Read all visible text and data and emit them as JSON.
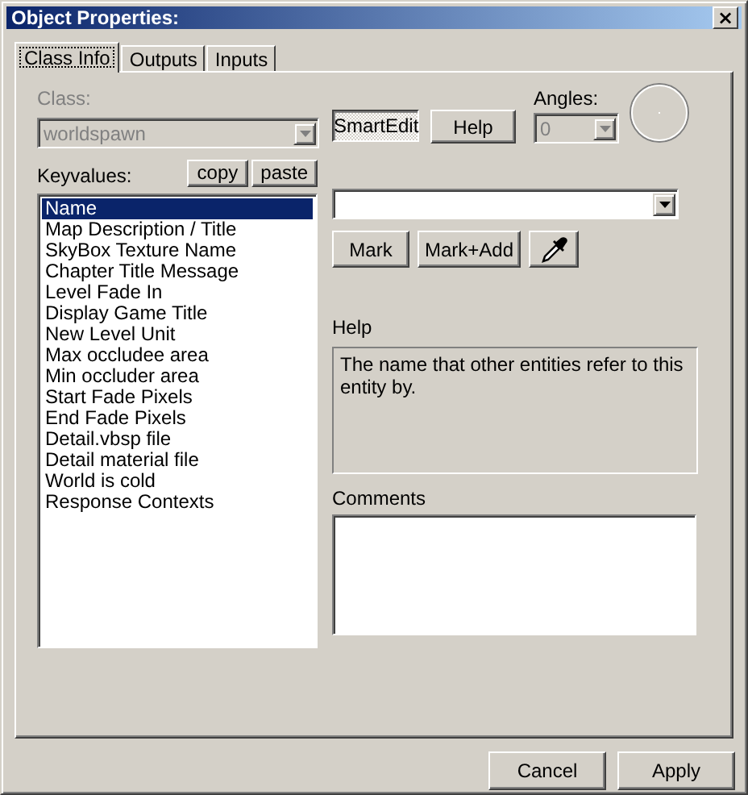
{
  "window": {
    "title": "Object Properties:",
    "close": "×"
  },
  "tabs": [
    {
      "label": "Class Info",
      "selected": true
    },
    {
      "label": "Outputs",
      "selected": false
    },
    {
      "label": "Inputs",
      "selected": false
    }
  ],
  "class_field": {
    "label": "Class:",
    "value": "worldspawn",
    "disabled": true
  },
  "smartedit_button": {
    "label": "SmartEdit",
    "pressed": true
  },
  "help_button": "Help",
  "angles": {
    "label": "Angles:",
    "value": "0",
    "disabled": true
  },
  "keyvalues": {
    "label": "Keyvalues:",
    "copy": "copy",
    "paste": "paste",
    "items": [
      {
        "label": "Name",
        "selected": true
      },
      {
        "label": "Map Description / Title",
        "selected": false
      },
      {
        "label": "SkyBox Texture Name",
        "selected": false
      },
      {
        "label": "Chapter Title Message",
        "selected": false
      },
      {
        "label": "Level Fade In",
        "selected": false
      },
      {
        "label": "Display Game Title",
        "selected": false
      },
      {
        "label": "New Level Unit",
        "selected": false
      },
      {
        "label": "Max occludee area",
        "selected": false
      },
      {
        "label": "Min occluder area",
        "selected": false
      },
      {
        "label": "Start Fade Pixels",
        "selected": false
      },
      {
        "label": "End Fade Pixels",
        "selected": false
      },
      {
        "label": "Detail.vbsp file",
        "selected": false
      },
      {
        "label": "Detail material file",
        "selected": false
      },
      {
        "label": "World is cold",
        "selected": false
      },
      {
        "label": "Response Contexts",
        "selected": false
      }
    ]
  },
  "mark_buttons": [
    "Mark",
    "Mark+Add"
  ],
  "help": {
    "label": "Help",
    "text": "The name that other entities refer to this entity by."
  },
  "comments": {
    "label": "Comments"
  },
  "buttons": [
    "Cancel",
    "Apply"
  ]
}
